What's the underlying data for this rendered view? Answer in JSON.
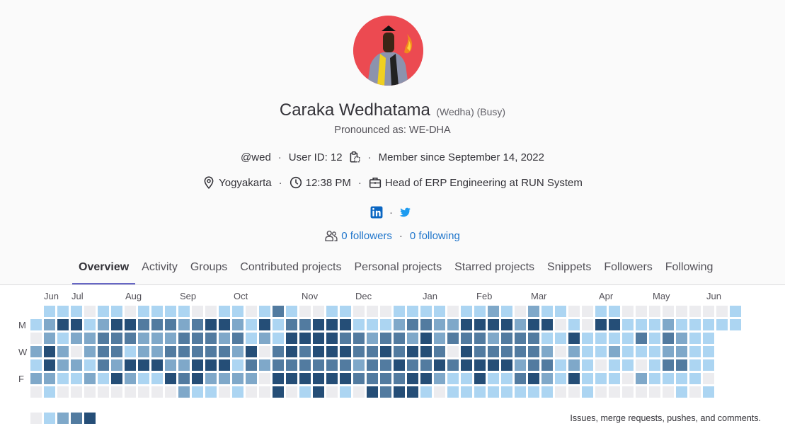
{
  "profile": {
    "name": "Caraka Wedhatama",
    "name_extra": "(Wedha) (Busy)",
    "pronounced": "Pronounced as: WE-DHA",
    "username": "@wed",
    "user_id": "User ID: 12",
    "member_since": "Member since September 14, 2022",
    "location": "Yogyakarta",
    "local_time": "12:38 PM",
    "job": "Head of ERP Engineering at RUN System",
    "followers": "0 followers",
    "following": "0 following",
    "icons": [
      "copy-icon",
      "location-icon",
      "clock-icon",
      "briefcase-icon",
      "linkedin-icon",
      "twitter-icon",
      "users-icon"
    ],
    "link_color": "#1f75cb"
  },
  "tabs": [
    "Overview",
    "Activity",
    "Groups",
    "Contributed projects",
    "Personal projects",
    "Starred projects",
    "Snippets",
    "Followers",
    "Following"
  ],
  "active_tab": "Overview",
  "calendar": {
    "months": [
      "Jun",
      "Jul",
      "Aug",
      "Sep",
      "Oct",
      "Nov",
      "Dec",
      "Jan",
      "Feb",
      "Mar",
      "Apr",
      "May",
      "Jun"
    ],
    "day_labels": [
      "M",
      "W",
      "F"
    ],
    "caption": "Issues, merge requests, pushes, and comments.",
    "level_colors": [
      "#ececef",
      "#acd5f2",
      "#7fa8c9",
      "#527ba0",
      "#254e77"
    ],
    "weeks": [
      [
        null,
        1,
        0,
        2,
        1,
        2,
        0
      ],
      [
        1,
        2,
        2,
        4,
        4,
        2,
        1
      ],
      [
        1,
        4,
        1,
        2,
        2,
        1,
        0
      ],
      [
        1,
        4,
        2,
        0,
        2,
        1,
        0
      ],
      [
        0,
        1,
        2,
        2,
        1,
        2,
        0
      ],
      [
        1,
        2,
        3,
        3,
        3,
        1,
        0
      ],
      [
        1,
        4,
        3,
        3,
        2,
        4,
        0
      ],
      [
        0,
        4,
        3,
        1,
        4,
        2,
        0
      ],
      [
        1,
        3,
        2,
        2,
        4,
        1,
        0
      ],
      [
        1,
        3,
        2,
        2,
        4,
        1,
        0
      ],
      [
        1,
        3,
        2,
        3,
        2,
        4,
        0
      ],
      [
        1,
        2,
        3,
        3,
        2,
        3,
        2
      ],
      [
        0,
        3,
        3,
        3,
        4,
        4,
        1
      ],
      [
        0,
        4,
        3,
        3,
        4,
        2,
        1
      ],
      [
        1,
        4,
        2,
        3,
        4,
        2,
        0
      ],
      [
        1,
        2,
        3,
        2,
        1,
        2,
        1
      ],
      [
        0,
        1,
        1,
        4,
        3,
        2,
        0
      ],
      [
        1,
        4,
        2,
        0,
        2,
        0,
        0
      ],
      [
        3,
        1,
        1,
        3,
        3,
        4,
        4
      ],
      [
        1,
        3,
        4,
        4,
        3,
        4,
        0
      ],
      [
        0,
        3,
        4,
        3,
        3,
        4,
        1
      ],
      [
        0,
        4,
        4,
        4,
        3,
        4,
        4
      ],
      [
        1,
        4,
        4,
        4,
        3,
        4,
        0
      ],
      [
        1,
        4,
        3,
        4,
        3,
        4,
        1
      ],
      [
        0,
        1,
        3,
        3,
        2,
        3,
        0
      ],
      [
        0,
        1,
        2,
        3,
        3,
        3,
        4
      ],
      [
        0,
        1,
        3,
        4,
        3,
        3,
        3
      ],
      [
        1,
        2,
        3,
        3,
        4,
        3,
        4
      ],
      [
        1,
        3,
        2,
        4,
        3,
        4,
        4
      ],
      [
        1,
        3,
        4,
        4,
        3,
        4,
        1
      ],
      [
        1,
        2,
        2,
        3,
        4,
        2,
        0
      ],
      [
        0,
        2,
        3,
        0,
        3,
        1,
        1
      ],
      [
        1,
        4,
        3,
        4,
        4,
        1,
        1
      ],
      [
        1,
        4,
        3,
        3,
        4,
        4,
        1
      ],
      [
        2,
        4,
        2,
        3,
        4,
        1,
        1
      ],
      [
        1,
        4,
        3,
        3,
        4,
        1,
        1
      ],
      [
        0,
        2,
        3,
        3,
        2,
        3,
        1
      ],
      [
        2,
        4,
        3,
        3,
        3,
        4,
        1
      ],
      [
        1,
        4,
        1,
        2,
        3,
        2,
        1
      ],
      [
        1,
        0,
        1,
        0,
        1,
        1,
        0
      ],
      [
        0,
        1,
        4,
        2,
        2,
        4,
        0
      ],
      [
        0,
        0,
        1,
        1,
        1,
        1,
        1
      ],
      [
        1,
        4,
        1,
        1,
        0,
        1,
        0
      ],
      [
        1,
        4,
        1,
        2,
        1,
        1,
        0
      ],
      [
        0,
        1,
        1,
        1,
        1,
        0,
        0
      ],
      [
        0,
        1,
        3,
        1,
        0,
        2,
        0
      ],
      [
        0,
        1,
        1,
        1,
        1,
        1,
        0
      ],
      [
        0,
        2,
        3,
        2,
        3,
        1,
        0
      ],
      [
        0,
        1,
        2,
        2,
        3,
        1,
        1
      ],
      [
        0,
        1,
        1,
        1,
        1,
        1,
        0
      ],
      [
        0,
        1,
        1,
        1,
        1,
        0,
        1
      ],
      [
        0,
        1,
        null,
        null,
        null,
        null,
        null
      ],
      [
        1,
        1,
        null,
        null,
        null,
        null,
        null
      ]
    ]
  }
}
